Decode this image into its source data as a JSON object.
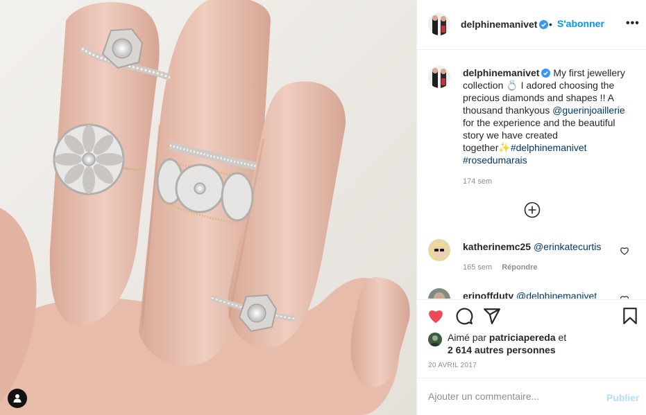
{
  "post": {
    "username": "delphinemanivet",
    "follow_label": "S'abonner",
    "separator": "•",
    "more_label": "•••",
    "caption": {
      "username": "delphinemanivet",
      "text_1": " My first jewellery collection ",
      "emoji_1": "💍",
      "text_2": " I adored choosing the precious diamonds and shapes !! A thousand thankyous ",
      "mention": "@guerinjoaillerie",
      "text_3": " for the experience and the beautiful story we have created together",
      "emoji_2": "✨",
      "hashtag_1": "#delphinemanivet",
      "hashtag_2": "#rosedumarais",
      "time": "174 sem"
    },
    "comments": [
      {
        "username": "katherinemc25",
        "text": "@erinkatecurtis",
        "time": "165 sem",
        "reply_label": "Répondre"
      },
      {
        "username": "erinoffduty",
        "text": "@delphinemanivet"
      }
    ],
    "likes": {
      "prefix": "Aimé par ",
      "user": "patriciapereda",
      "middle": " et",
      "count": "2 614 autres personnes"
    },
    "date": "20 AVRIL 2017",
    "add_comment_placeholder": "Ajouter un commentaire...",
    "publish_label": "Publier"
  },
  "icons": {
    "like": "heart-icon",
    "comment": "comment-icon",
    "share": "share-icon",
    "save": "bookmark-icon",
    "load_more": "plus-circle-icon",
    "user_tag": "user-icon",
    "verified": "verified-badge-icon"
  },
  "colors": {
    "like_red": "#ed4956",
    "link_blue": "#0095f6",
    "mention_blue": "#00376b",
    "muted_grey": "#8e8e8e"
  }
}
